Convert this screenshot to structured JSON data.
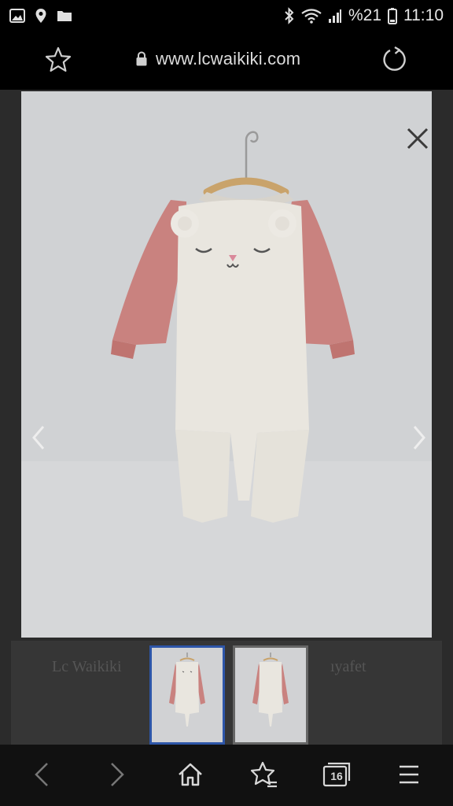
{
  "status_bar": {
    "battery_percent": "%21",
    "time": "11:10",
    "icons": [
      "gallery-icon",
      "location-icon",
      "folder-icon",
      "bluetooth-icon",
      "wifi-icon",
      "signal-icon",
      "battery-icon"
    ]
  },
  "browser": {
    "url": "www.lcwaikiki.com",
    "tab_count": "16"
  },
  "viewer": {
    "image_index": 1,
    "thumbnail_count": 2,
    "colors": {
      "garment_body": "#e9e6df",
      "garment_sleeves": "#c9827f",
      "hanger": "#c9a36b",
      "active_border": "#2e56a8"
    }
  },
  "background_page": {
    "dimmed_text_left": "Lc Waikiki",
    "dimmed_text_right": "ıyafet"
  }
}
